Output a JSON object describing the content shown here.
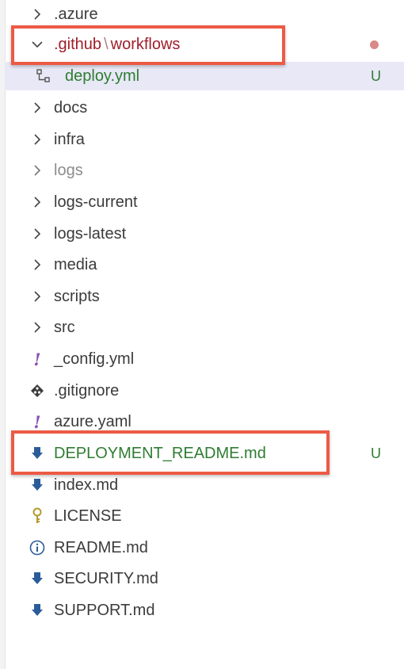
{
  "explorer": {
    "items": [
      {
        "label": ".azure",
        "type": "folder"
      },
      {
        "label_parts": [
          ".github",
          "workflows"
        ],
        "type": "folder-open",
        "status_dot_color": "#d98989"
      },
      {
        "label": "deploy.yml",
        "type": "file",
        "icon": "workflow-icon",
        "git_status": "U"
      },
      {
        "label": "docs",
        "type": "folder"
      },
      {
        "label": "infra",
        "type": "folder"
      },
      {
        "label": "logs",
        "type": "folder",
        "ignored": true
      },
      {
        "label": "logs-current",
        "type": "folder"
      },
      {
        "label": "logs-latest",
        "type": "folder"
      },
      {
        "label": "media",
        "type": "folder"
      },
      {
        "label": "scripts",
        "type": "folder"
      },
      {
        "label": "src",
        "type": "folder"
      },
      {
        "label": "_config.yml",
        "type": "file",
        "icon": "yaml-exclamation-icon"
      },
      {
        "label": ".gitignore",
        "type": "file",
        "icon": "git-diamond-icon"
      },
      {
        "label": "azure.yaml",
        "type": "file",
        "icon": "yaml-exclamation-icon"
      },
      {
        "label": "DEPLOYMENT_README.md",
        "type": "file",
        "icon": "markdown-download-icon",
        "git_status": "U"
      },
      {
        "label": "index.md",
        "type": "file",
        "icon": "markdown-download-icon"
      },
      {
        "label": "LICENSE",
        "type": "file",
        "icon": "license-key-icon"
      },
      {
        "label": "README.md",
        "type": "file",
        "icon": "info-icon"
      },
      {
        "label": "SECURITY.md",
        "type": "file",
        "icon": "markdown-download-icon"
      },
      {
        "label": "SUPPORT.md",
        "type": "file",
        "icon": "markdown-download-icon"
      }
    ]
  },
  "colors": {
    "highlight_box": "#ec5a45",
    "untracked_green": "#2e7d32",
    "modified_red": "#a01e2a",
    "selection_bg": "#e8e8f6"
  }
}
